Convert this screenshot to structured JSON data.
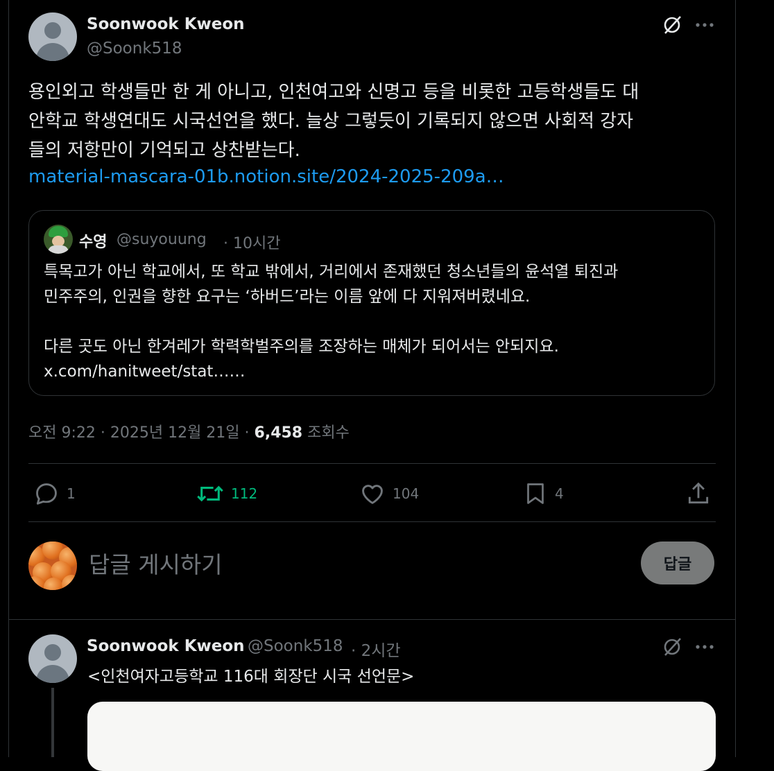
{
  "main_tweet": {
    "author_name": "Soonwook Kweon",
    "author_handle": "@Soonk518",
    "text_line1": "용인외고 학생들만 한 게 아니고, 인천여고와 신명고 등을 비롯한 고등학생들도 대",
    "text_line2": "안학교 학생연대도 시국선언을 했다. 늘상 그렇듯이 기록되지 않으면 사회적 강자",
    "text_line3": "들의 저항만이 기억되고 상찬받는다.",
    "link": "material-mascara-01b.notion.site/2024-2025-209a…",
    "quoted": {
      "name": "수영",
      "handle": "@suyouung",
      "time": "· 10시간",
      "line1": "특목고가 아닌 학교에서, 또 학교 밖에서, 거리에서 존재했던 청소년들의 윤석열 퇴진과",
      "line2": "민주주의, 인권을 향한 요구는 ‘하버드’라는 이름 앞에 다 지워져버렸네요.",
      "line3": "다른 곳도 아닌 한겨레가 학력학벌주의를 조장하는 매체가 되어서는 안되지요.",
      "line4": "x.com/hanitweet/stat……"
    },
    "meta_time": "오전 9:22 · 2025년 12월 21일 ·",
    "views_count": "6,458",
    "views_label": "조회수",
    "actions": {
      "replies": "1",
      "retweets": "112",
      "likes": "104",
      "bookmarks": "4"
    }
  },
  "reply_box": {
    "placeholder": "답글 게시하기",
    "button_label": "답글"
  },
  "second_tweet": {
    "author_name": "Soonwook Kweon",
    "author_handle": "@Soonk518",
    "time": "· 2시간",
    "text": "<인천여자고등학교 116대 회장단 시국 선언문>"
  },
  "colors": {
    "background": "#000000",
    "text": "#e7e9ea",
    "muted": "#71767b",
    "link": "#1d9bf0",
    "retweet_green": "#00ba7c",
    "border": "#2f3336"
  },
  "icons": [
    "grok-icon",
    "more-icon",
    "reply-icon",
    "retweet-icon",
    "like-icon",
    "bookmark-icon",
    "share-icon"
  ]
}
